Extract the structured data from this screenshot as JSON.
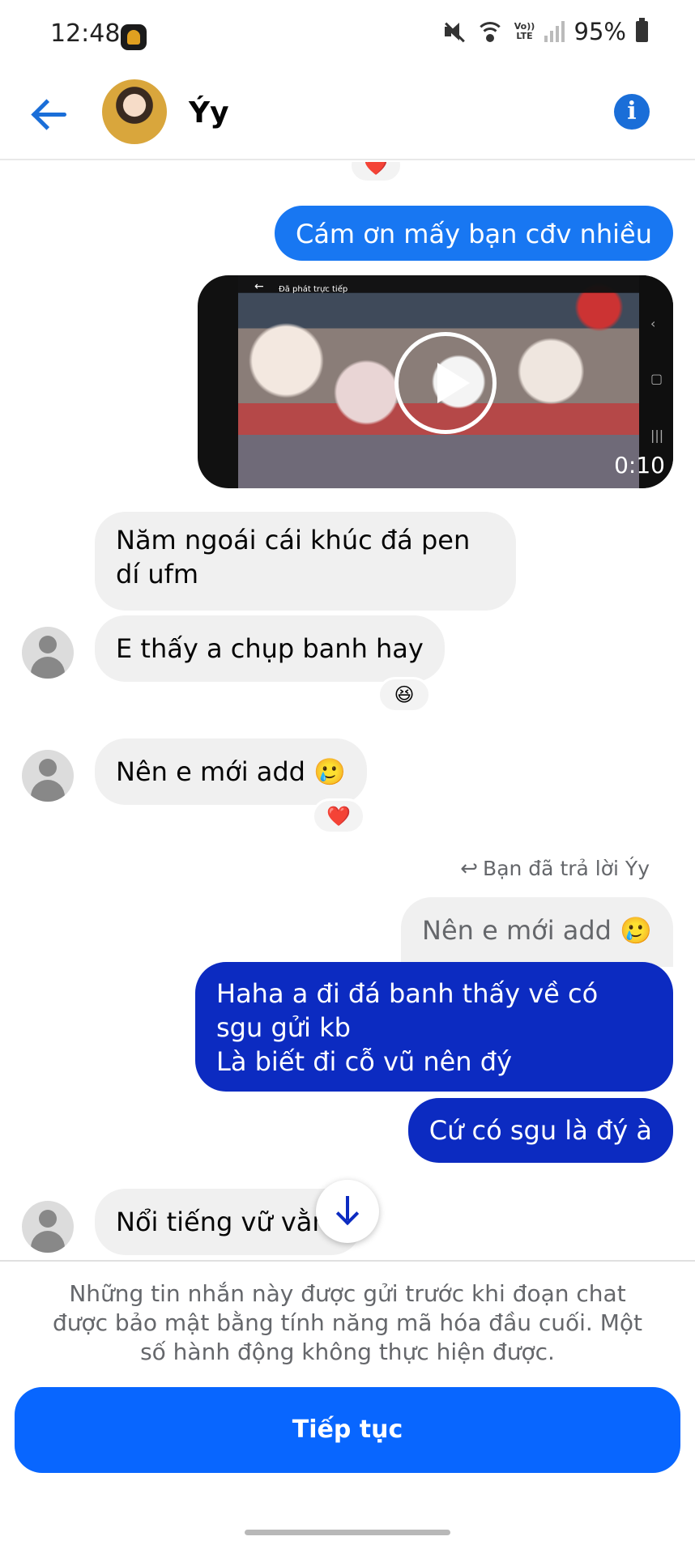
{
  "status_bar": {
    "time": "12:48",
    "volte_top": "Vo))",
    "volte_bottom": "LTE",
    "battery": "95%"
  },
  "header": {
    "contact_name": "Ýy",
    "info_label": "i"
  },
  "messages": {
    "top_reaction": "❤️",
    "sent_1": "Cám ơn mấy bạn cđv nhiều",
    "video": {
      "overlay_title": "Đã phát trực tiếp",
      "duration": "0:10"
    },
    "received_1": "Năm ngoái cái khúc đá pen dí ufm",
    "received_2": "E thấy a chụp banh hay",
    "reaction_2": "😆",
    "received_3": "Nên e mới add 🥲",
    "reaction_3": "❤️",
    "replied_to_label": "Bạn đã trả lời Ýy",
    "quoted_message": "Nên e mới add 🥲",
    "sent_2": "Haha a đi đá banh thấy về có sgu gửi kb\nLà biết đi cỗ vũ nên đý",
    "sent_3": "Cứ có sgu là đý à",
    "received_4": "Nổi tiếng vữ vằn"
  },
  "footer": {
    "notice": "Những tin nhắn này được gửi trước khi đoạn chat được bảo mật bằng tính năng mã hóa đầu cuối. Một số hành động không thực hiện được.",
    "continue_label": "Tiếp tục"
  },
  "colors": {
    "messenger_blue": "#1877f2",
    "sent_dark_blue": "#0c2bc1",
    "button_blue": "#0866ff",
    "received_gray": "#f0f0f0"
  }
}
